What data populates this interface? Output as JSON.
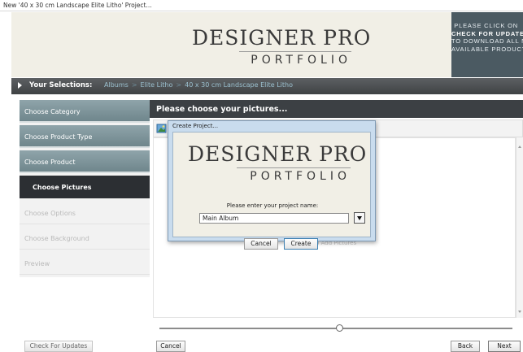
{
  "window": {
    "title": "New '40 x 30 cm Landscape Elite Litho' Project..."
  },
  "brand": {
    "line1": "DESIGNER PRO",
    "line2": "PORTFOLIO"
  },
  "updates_promo": {
    "line1": "PLEASE CLICK ON",
    "line2": "CHECK FOR UPDATES",
    "line3": "TO DOWNLOAD ALL NEW",
    "line4": "AVAILABLE PRODUCTS"
  },
  "selections": {
    "label": "Your Selections:",
    "crumbs": [
      "Albums",
      "Elite Litho",
      "40 x 30 cm Landscape Elite Litho"
    ]
  },
  "sidebar": {
    "items": [
      {
        "label": "Choose Category",
        "state": "done"
      },
      {
        "label": "Choose Product Type",
        "state": "done"
      },
      {
        "label": "Choose Product",
        "state": "done"
      },
      {
        "label": "Choose Pictures",
        "state": "active"
      },
      {
        "label": "Choose Options",
        "state": "todo"
      },
      {
        "label": "Choose Background",
        "state": "todo"
      },
      {
        "label": "Preview",
        "state": "todo"
      }
    ]
  },
  "main": {
    "heading": "Please choose your pictures...",
    "add_pictures_hint": "To Add Pictures"
  },
  "dialog": {
    "title": "Create Project...",
    "prompt": "Please enter your project name:",
    "project_name_value": "Main Album",
    "cancel_label": "Cancel",
    "create_label": "Create"
  },
  "footer": {
    "check_updates_label": "Check For Updates",
    "cancel_label": "Cancel",
    "back_label": "Back",
    "next_label": "Next"
  },
  "colors": {
    "banner_bg": "#f1efe6",
    "promo_bg": "#4b5a62",
    "sidebar_done": "#7d939a",
    "sidebar_active": "#2c2f33",
    "dialog_frame": "#c9dcee"
  }
}
